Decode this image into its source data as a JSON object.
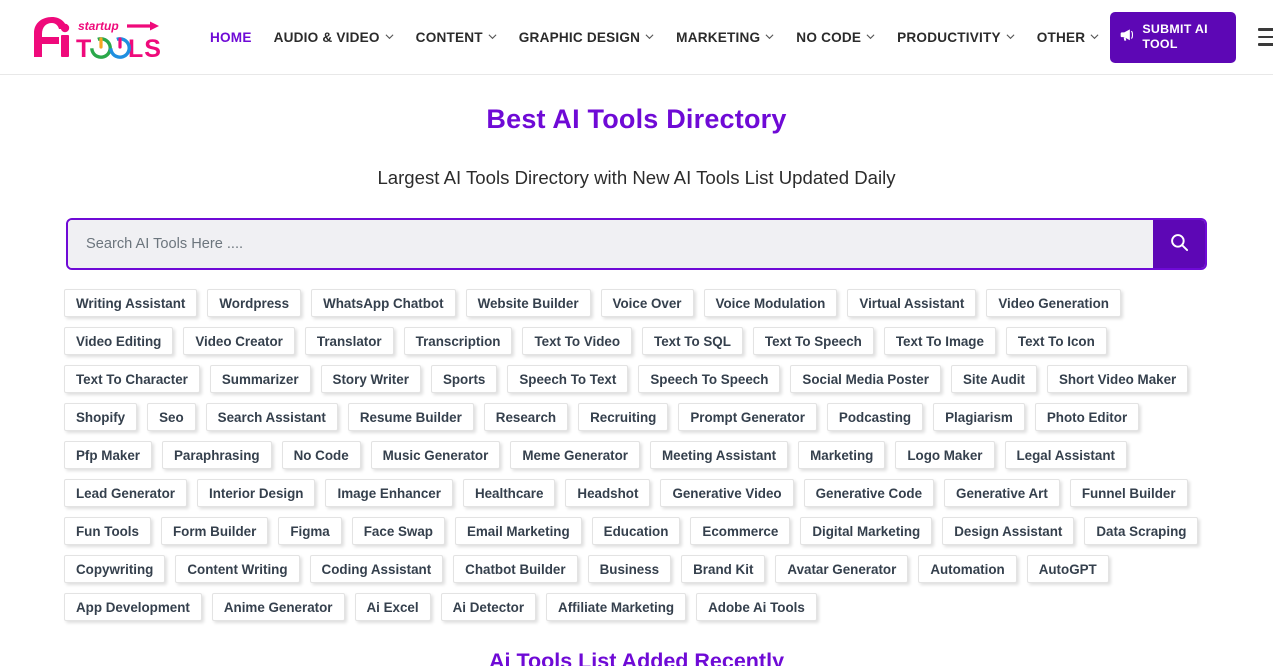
{
  "header": {
    "logo": {
      "name": "ai-startup-tools-logo",
      "text_ai": "Ai",
      "text_startup": "startup",
      "text_tools": "TOOLS",
      "color_pink": "#ef0a7b",
      "color_power_green": "#2aa84a",
      "color_power_orange": "#f5a623",
      "color_power_blue": "#1f8fe0"
    },
    "nav": [
      {
        "label": "HOME",
        "active": true,
        "has_caret": false
      },
      {
        "label": "AUDIO & VIDEO",
        "active": false,
        "has_caret": true
      },
      {
        "label": "CONTENT",
        "active": false,
        "has_caret": true
      },
      {
        "label": "GRAPHIC DESIGN",
        "active": false,
        "has_caret": true
      },
      {
        "label": "MARKETING",
        "active": false,
        "has_caret": true
      },
      {
        "label": "NO CODE",
        "active": false,
        "has_caret": true
      },
      {
        "label": "PRODUCTIVITY",
        "active": false,
        "has_caret": true
      },
      {
        "label": "OTHER",
        "active": false,
        "has_caret": true
      }
    ],
    "submit_button": {
      "label": "SUBMIT AI TOOL",
      "icon": "bullhorn-icon",
      "bg_color": "#5d07b5",
      "text_color": "#ffffff"
    },
    "menu_toggle_icon": "hamburger-icon"
  },
  "hero": {
    "title": "Best AI Tools Directory",
    "title_color": "#6f0ad6",
    "subtitle": "Largest AI Tools Directory with New AI Tools List Updated Daily"
  },
  "search": {
    "placeholder": "Search AI Tools Here ....",
    "value": "",
    "button_icon": "search-icon",
    "border_color": "#6f0ad6",
    "button_bg": "#5d07b5"
  },
  "tags": [
    "Writing Assistant",
    "Wordpress",
    "WhatsApp Chatbot",
    "Website Builder",
    "Voice Over",
    "Voice Modulation",
    "Virtual Assistant",
    "Video Generation",
    "Video Editing",
    "Video Creator",
    "Translator",
    "Transcription",
    "Text To Video",
    "Text To SQL",
    "Text To Speech",
    "Text To Image",
    "Text To Icon",
    "Text To Character",
    "Summarizer",
    "Story Writer",
    "Sports",
    "Speech To Text",
    "Speech To Speech",
    "Social Media Poster",
    "Site Audit",
    "Short Video Maker",
    "Shopify",
    "Seo",
    "Search Assistant",
    "Resume Builder",
    "Research",
    "Recruiting",
    "Prompt Generator",
    "Podcasting",
    "Plagiarism",
    "Photo Editor",
    "Pfp Maker",
    "Paraphrasing",
    "No Code",
    "Music Generator",
    "Meme Generator",
    "Meeting Assistant",
    "Marketing",
    "Logo Maker",
    "Legal Assistant",
    "Lead Generator",
    "Interior Design",
    "Image Enhancer",
    "Healthcare",
    "Headshot",
    "Generative Video",
    "Generative Code",
    "Generative Art",
    "Funnel Builder",
    "Fun Tools",
    "Form Builder",
    "Figma",
    "Face Swap",
    "Email Marketing",
    "Education",
    "Ecommerce",
    "Digital Marketing",
    "Design Assistant",
    "Data Scraping",
    "Copywriting",
    "Content Writing",
    "Coding Assistant",
    "Chatbot Builder",
    "Business",
    "Brand Kit",
    "Avatar Generator",
    "Automation",
    "AutoGPT",
    "App Development",
    "Anime Generator",
    "Ai Excel",
    "Ai Detector",
    "Affiliate Marketing",
    "Adobe Ai Tools"
  ],
  "recent_section": {
    "title": "Ai Tools List Added Recently"
  }
}
